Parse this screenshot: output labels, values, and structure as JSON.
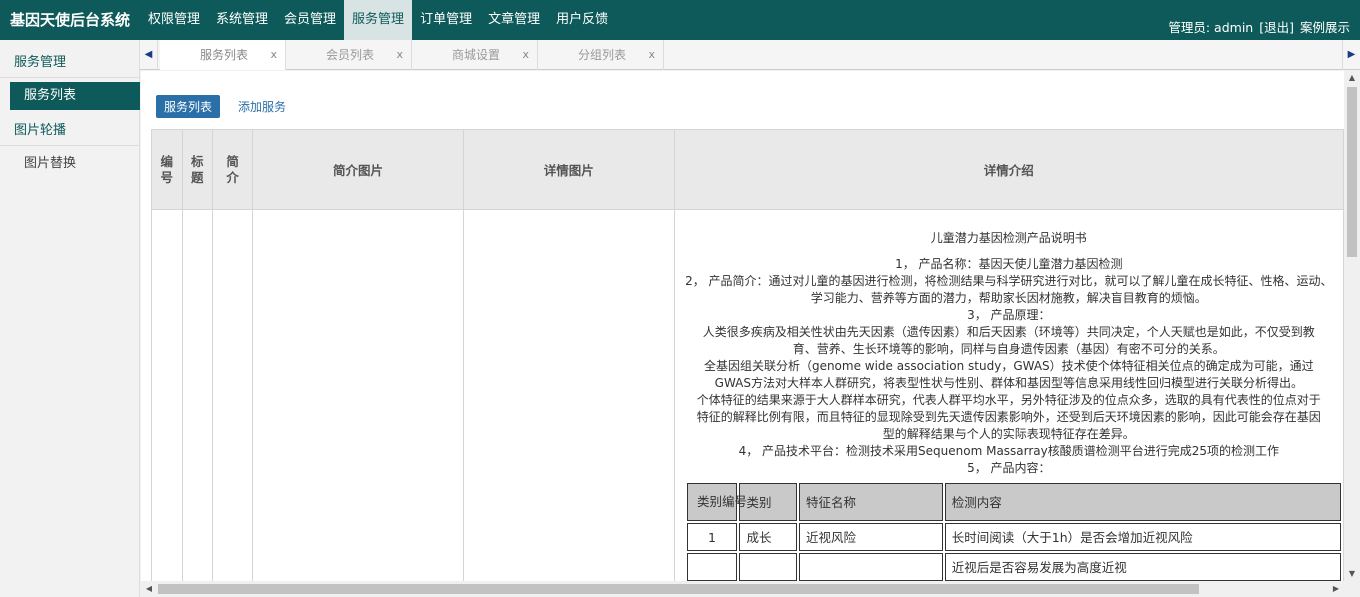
{
  "app": {
    "title": "基因天使后台系统",
    "nav": [
      "权限管理",
      "系统管理",
      "会员管理",
      "服务管理",
      "订单管理",
      "文章管理",
      "用户反馈"
    ],
    "active_nav": "服务管理",
    "user_label": "管理员: admin",
    "logout": "[退出]",
    "case_show": "案例展示"
  },
  "sidebar": {
    "groups": [
      {
        "title": "服务管理",
        "items": [
          "服务列表"
        ]
      },
      {
        "title": "图片轮播",
        "items": [
          "图片替换"
        ]
      }
    ],
    "active_item": "服务列表"
  },
  "tabs": [
    {
      "label": "服务列表",
      "close": "x"
    },
    {
      "label": "会员列表",
      "close": "x"
    },
    {
      "label": "商城设置",
      "close": "x"
    },
    {
      "label": "分组列表",
      "close": "x"
    }
  ],
  "icons": {
    "left_arrow": "left-arrow-icon",
    "right_arrow": "right-arrow-icon"
  },
  "subnav": {
    "list_btn": "服务列表",
    "add_link": "添加服务"
  },
  "table": {
    "headers": [
      "编号",
      "标题",
      "简介",
      "简介图片",
      "详情图片",
      "详情介绍"
    ]
  },
  "detail": {
    "lines": [
      "儿童潜力基因检测产品说明书",
      "",
      "1， 产品名称：基因天使儿童潜力基因检测",
      "2， 产品简介：通过对儿童的基因进行检测，将检测结果与科学研究进行对比，就可以了解儿童在成长特征、性格、运动、",
      "学习能力、营养等方面的潜力，帮助家长因材施教，解决盲目教育的烦恼。",
      "3， 产品原理：",
      "人类很多疾病及相关性状由先天因素（遗传因素）和后天因素（环境等）共同决定，个人天赋也是如此，不仅受到教",
      "育、营养、生长环境等的影响，同样与自身遗传因素（基因）有密不可分的关系。",
      "全基因组关联分析（genome wide association study，GWAS）技术使个体特征相关位点的确定成为可能，通过",
      "GWAS方法对大样本人群研究，将表型性状与性别、群体和基因型等信息采用线性回归模型进行关联分析得出。",
      "个体特征的结果来源于大人群样本研究，代表人群平均水平，另外特征涉及的位点众多，选取的具有代表性的位点对于",
      "特征的解释比例有限，而且特征的显现除受到先天遗传因素影响外，还受到后天环境因素的影响，因此可能会存在基因",
      "型的解释结果与个人的实际表现特征存在差异。",
      "4， 产品技术平台：检测技术采用Sequenom Massarray核酸质谱检测平台进行完成25项的检测工作",
      "5， 产品内容："
    ],
    "inner_headers": [
      "类别编号",
      "类别",
      "特征名称",
      "检测内容"
    ],
    "inner_rows": [
      [
        "1",
        "成长",
        "近视风险",
        "长时间阅读（大于1h）是否会增加近视风险"
      ],
      [
        "",
        "",
        "",
        "近视后是否容易发展为高度近视"
      ]
    ]
  }
}
